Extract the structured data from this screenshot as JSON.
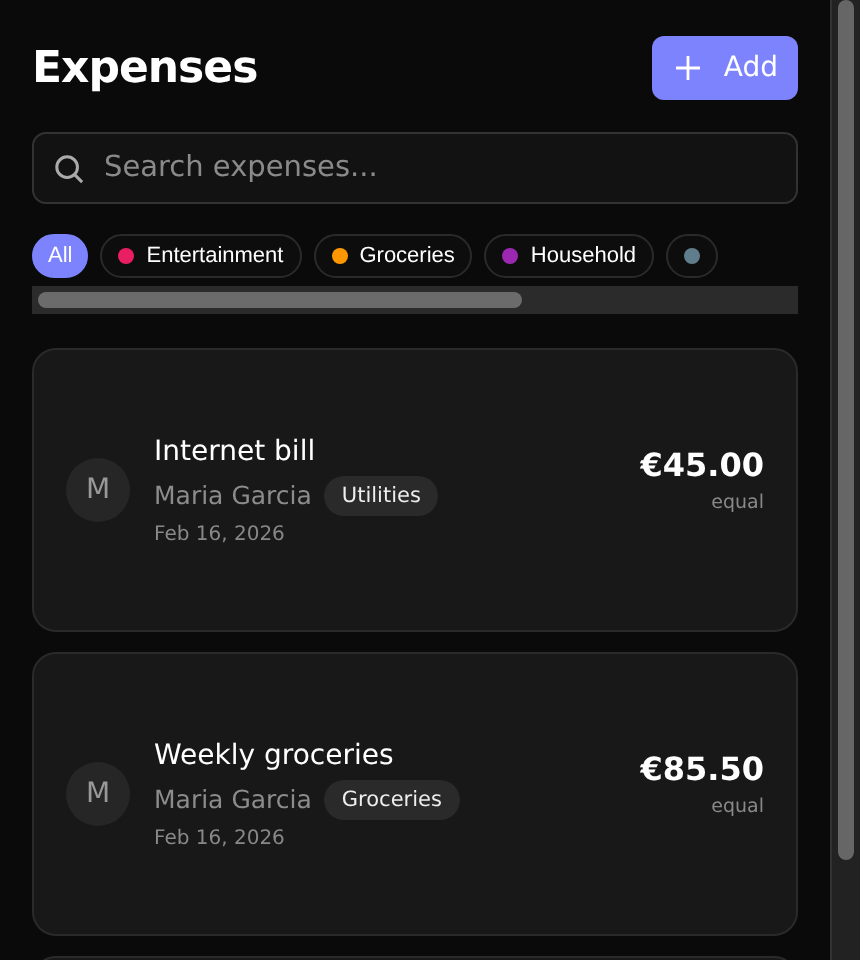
{
  "header": {
    "title": "Expenses",
    "add_button": "Add"
  },
  "search": {
    "placeholder": "Search expenses..."
  },
  "filters": [
    {
      "label": "All",
      "selected": true
    },
    {
      "label": "Entertainment",
      "color": "#e91e63",
      "selected": false
    },
    {
      "label": "Groceries",
      "color": "#ff9800",
      "selected": false
    },
    {
      "label": "Household",
      "color": "#9c27b0",
      "selected": false
    },
    {
      "color": "#607d8b",
      "selected": false
    }
  ],
  "expenses": [
    {
      "avatar": "M",
      "title": "Internet bill",
      "payer": "Maria Garcia",
      "category": "Utilities",
      "date": "Feb 16, 2026",
      "amount": "€45.00",
      "split": "equal"
    },
    {
      "avatar": "M",
      "title": "Weekly groceries",
      "payer": "Maria Garcia",
      "category": "Groceries",
      "date": "Feb 16, 2026",
      "amount": "€85.50",
      "split": "equal"
    }
  ]
}
